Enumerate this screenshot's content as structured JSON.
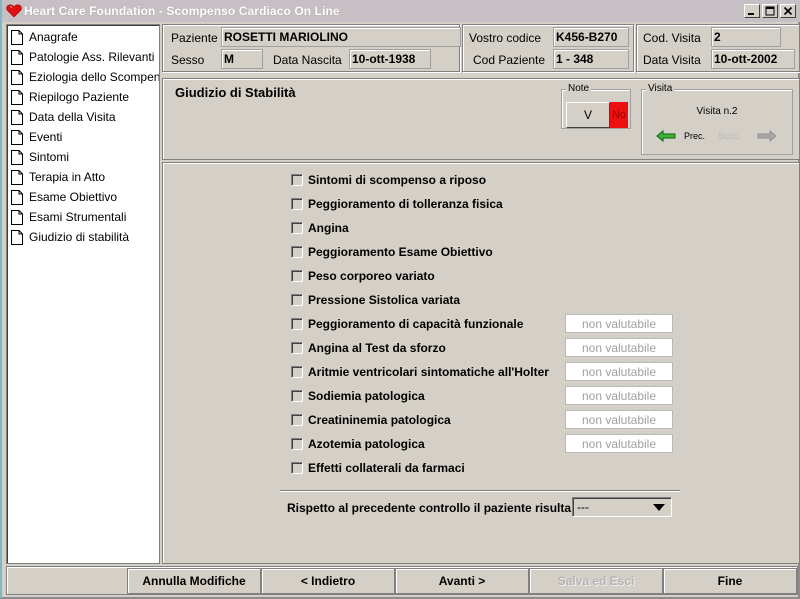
{
  "window": {
    "title": "Heart Care Foundation - Scompenso Cardiaco On Line",
    "controls": [
      "minimize",
      "maximize",
      "close"
    ]
  },
  "sidebar": {
    "items": [
      {
        "label": "Anagrafe"
      },
      {
        "label": "Patologie Ass. Rilevanti"
      },
      {
        "label": "Eziologia dello Scompenso"
      },
      {
        "label": "Riepilogo Paziente"
      },
      {
        "label": "Data della Visita"
      },
      {
        "label": "Eventi"
      },
      {
        "label": "Sintomi"
      },
      {
        "label": "Terapia in Atto"
      },
      {
        "label": "Esame Obiettivo"
      },
      {
        "label": "Esami Strumentali"
      },
      {
        "label": "Giudizio di stabilità"
      }
    ]
  },
  "patient": {
    "paziente_label": "Paziente",
    "paziente_value": "ROSETTI MARIOLINO",
    "sesso_label": "Sesso",
    "sesso_value": "M",
    "nascita_label": "Data Nascita",
    "nascita_value": "10-ott-1938"
  },
  "codes": {
    "vostro_codice_label": "Vostro codice",
    "vostro_codice_value": "K456-B270",
    "cod_paziente_label": "Cod Paziente",
    "cod_paziente_value": "1 - 348"
  },
  "visit": {
    "cod_visita_label": "Cod. Visita",
    "cod_visita_value": "2",
    "data_visita_label": "Data Visita",
    "data_visita_value": "10-ott-2002"
  },
  "section": {
    "title": "Giudizio di Stabilità",
    "note": {
      "legend": "Note",
      "v_label": "V",
      "no_label": "No",
      "no_color": "#ee1010"
    },
    "visita": {
      "legend": "Visita",
      "number_text": "Visita n.2",
      "prev_label": "Prec.",
      "next_label": "Succ.",
      "prev_arrow_color": "#1e8c1e",
      "next_arrow_color": "#a8a8a8"
    }
  },
  "checks": [
    {
      "label": "Sintomi di scompenso a riposo",
      "checked": false
    },
    {
      "label": "Peggioramento di tolleranza fisica",
      "checked": false
    },
    {
      "label": "Angina",
      "checked": false
    },
    {
      "label": "Peggioramento Esame Obiettivo",
      "checked": false
    },
    {
      "label": "Peso corporeo variato",
      "checked": false
    },
    {
      "label": "Pressione Sistolica variata",
      "checked": false
    },
    {
      "label": "Peggioramento di capacità funzionale",
      "checked": false,
      "field": "non valutabile"
    },
    {
      "label": "Angina al Test da sforzo",
      "checked": false,
      "field": "non valutabile"
    },
    {
      "label": "Aritmie ventricolari sintomatiche all'Holter",
      "checked": false,
      "field": "non valutabile"
    },
    {
      "label": "Sodiemia patologica",
      "checked": false,
      "field": "non valutabile"
    },
    {
      "label": "Creatininemia patologica",
      "checked": false,
      "field": "non valutabile"
    },
    {
      "label": "Azotemia patologica",
      "checked": false,
      "field": "non valutabile"
    },
    {
      "label": "Effetti collaterali da farmaci",
      "checked": false
    }
  ],
  "rispetto": {
    "label": "Rispetto al precedente controllo il paziente risulta",
    "selected": "---"
  },
  "buttons": {
    "annulla": "Annulla Modifiche",
    "indietro": "< Indietro",
    "avanti": "Avanti >",
    "salva": "Salva ed Esci",
    "fine": "Fine"
  }
}
